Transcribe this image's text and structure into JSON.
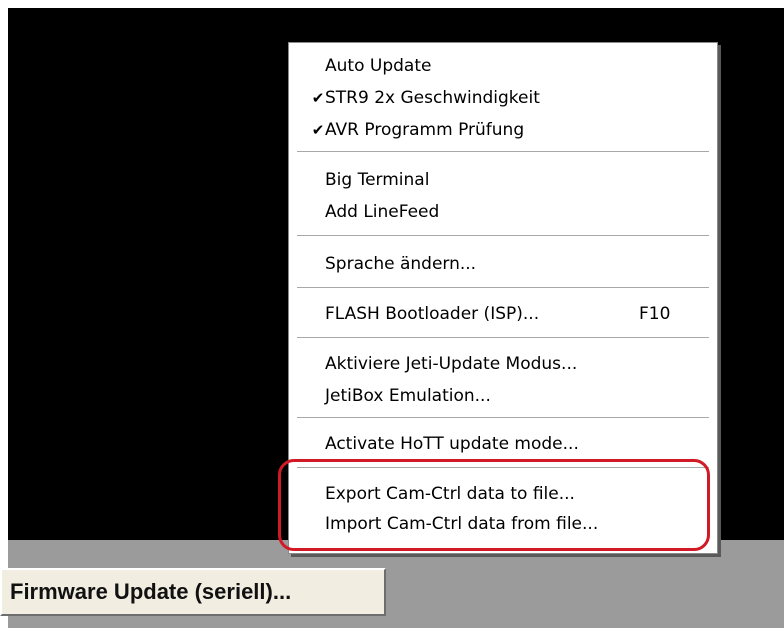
{
  "menu": {
    "items": [
      {
        "label": "Auto Update",
        "checked": false
      },
      {
        "label": "STR9 2x Geschwindigkeit",
        "checked": true
      },
      {
        "label": "AVR Programm Prüfung",
        "checked": true
      },
      {
        "label": "Big Terminal",
        "checked": false
      },
      {
        "label": "Add LineFeed",
        "checked": false
      },
      {
        "label": "Sprache ändern...",
        "checked": false
      },
      {
        "label": "FLASH Bootloader (ISP)...",
        "shortcut": "F10",
        "checked": false
      },
      {
        "label": "Aktiviere Jeti-Update Modus...",
        "checked": false
      },
      {
        "label": "JetiBox Emulation...",
        "checked": false
      },
      {
        "label": "Activate HoTT update mode...",
        "checked": false
      },
      {
        "label": "Export Cam-Ctrl data to file...",
        "checked": false
      },
      {
        "label": "Import  Cam-Ctrl data from file...",
        "checked": false
      }
    ],
    "check_glyph": "✔"
  },
  "button": {
    "firmware_label": "Firmware Update (seriell)..."
  },
  "colors": {
    "highlight_ring": "#d11a26",
    "background_dark": "#000000",
    "status_area": "#9b9b9b"
  },
  "icons": {
    "check": "checkmark-icon"
  }
}
